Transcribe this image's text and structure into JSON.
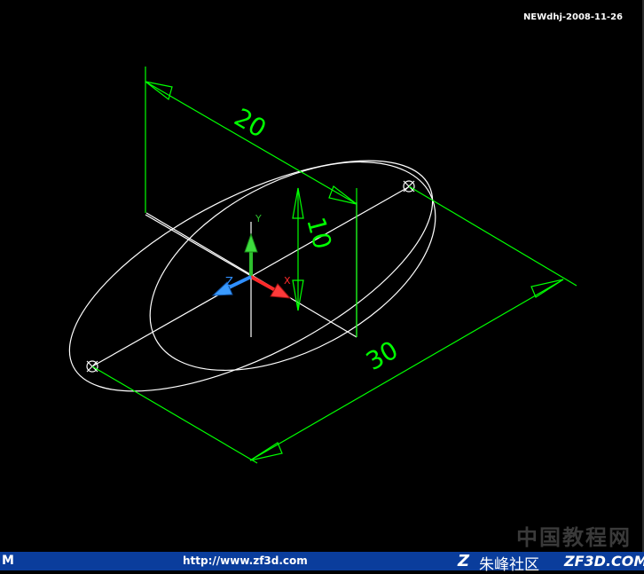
{
  "viewport": {
    "stamp": "NEWdhj-2008-11-26",
    "dimensions": [
      "20",
      "10",
      "30"
    ],
    "ucs_axis_labels": {
      "z": "Z",
      "x": "X",
      "y": "Y"
    },
    "colors": {
      "background": "#000000",
      "geometry": "#ffffff",
      "dimension": "#00ff00",
      "axis_x": "#ff2a2a",
      "axis_y": "#2dbf2d",
      "axis_z": "#2f8fff"
    }
  },
  "watermark": "中国教程网",
  "footer": {
    "left_mark": "M",
    "url": "http://www.zf3d.com",
    "logo_letter": "Z",
    "community": "朱峰社区",
    "brand": "ZF3D.COM"
  }
}
